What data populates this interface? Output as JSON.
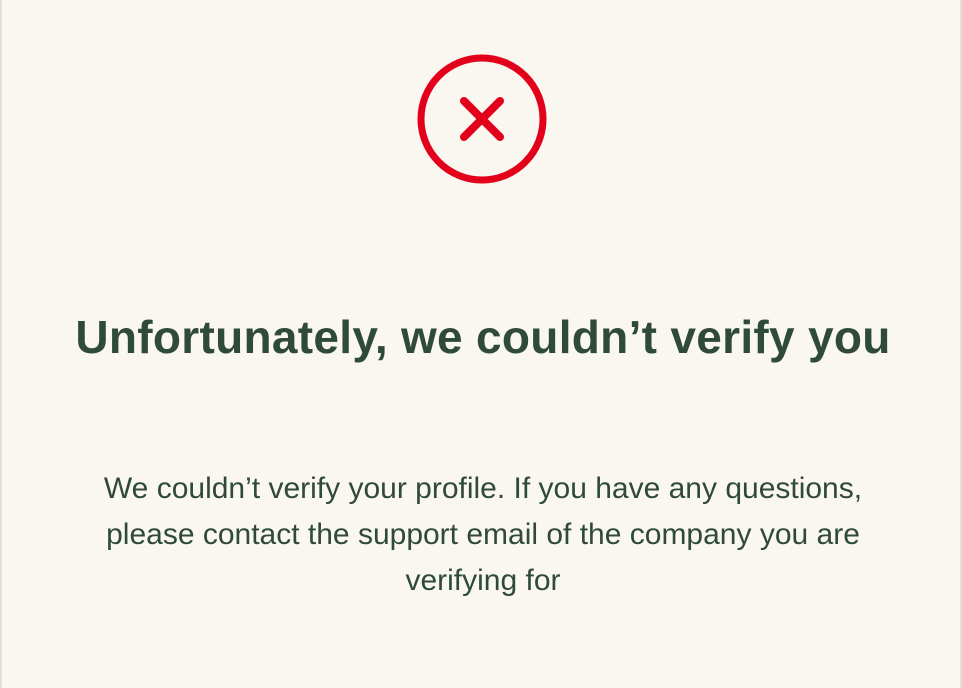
{
  "status": {
    "icon": "error-circle-x-icon",
    "accent_color": "#e2001a",
    "text_color": "#2f4a3a",
    "background_color": "#faf7f0"
  },
  "content": {
    "title": "Unfortunately, we couldn’t verify you",
    "message": "We couldn’t verify your profile. If you have any questions, please contact the support email of the company you are verifying for"
  }
}
